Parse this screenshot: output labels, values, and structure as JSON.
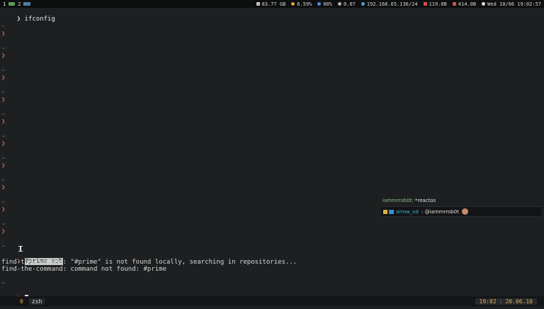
{
  "topbar": {
    "workspaces": [
      "1",
      "2"
    ],
    "disk": "83.77 GB",
    "cpu": "6.59%",
    "volume": "00%",
    "load": "0.07",
    "ip": "192.168.65.136/24",
    "down": "119.0B",
    "up": "414.0B",
    "datetime": "Wed 10/06 19:02:57"
  },
  "terminal": {
    "first_prompt": "❯",
    "first_command": "ifconfig",
    "tilde": "~",
    "prompt_symbol": "❯",
    "typed_command": "#prime sub",
    "error_line_1": "find-the-command: \"#prime\" is not found locally, searching in repositories...",
    "error_line_2": "find-the-command: command not found: #prime"
  },
  "chat": {
    "line1_user": "iammrrob0t",
    "line1_text": ": *reactos",
    "line2_user": "arrow_od",
    "line2_text": ": @iammrrob0t"
  },
  "tmux": {
    "window_index": "0",
    "window_name": "zsh",
    "time": "19:02",
    "date": "20.06.10"
  }
}
